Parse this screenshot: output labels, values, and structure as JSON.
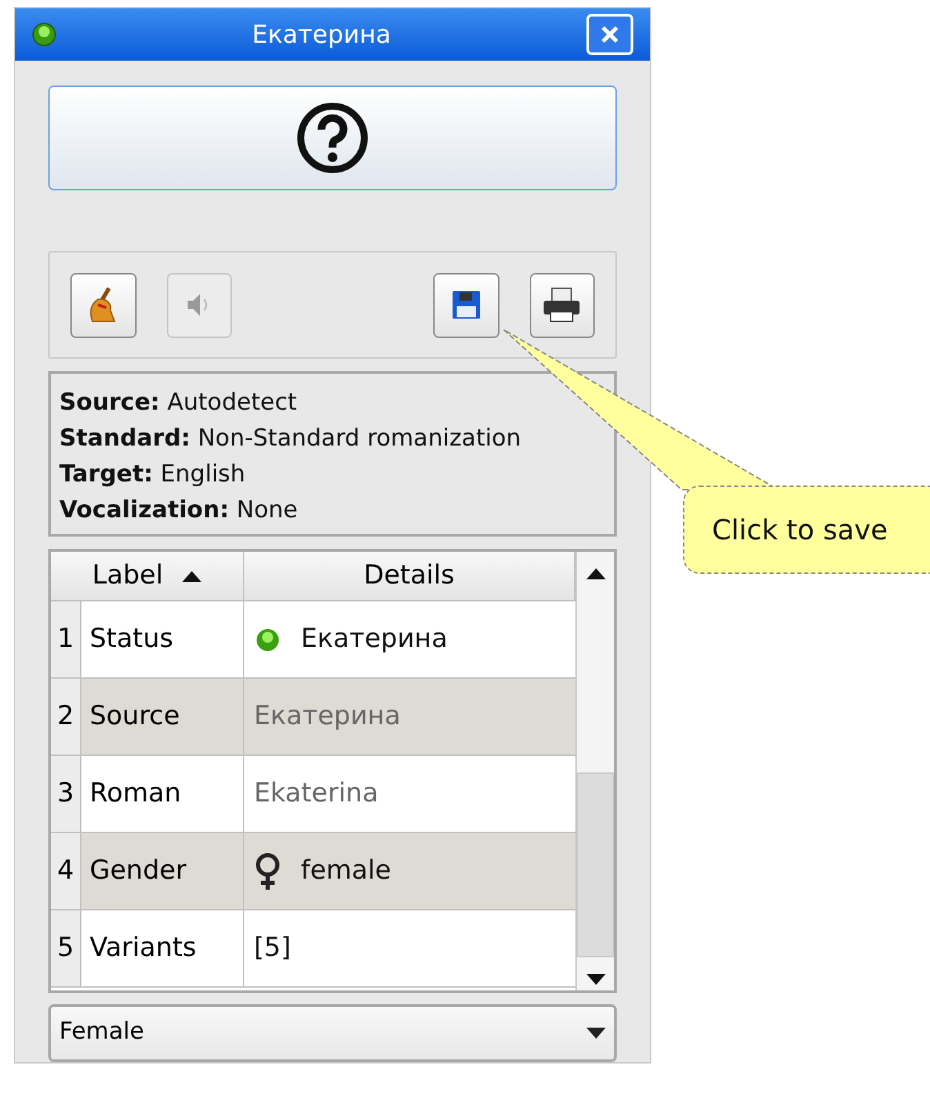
{
  "window": {
    "title": "Екатерина"
  },
  "toolbar": [
    {
      "kind": "broom",
      "disabled": false
    },
    {
      "kind": "speaker",
      "disabled": true
    },
    {
      "kind": "save",
      "disabled": false
    },
    {
      "kind": "print",
      "disabled": false
    }
  ],
  "info": [
    "**Source:** Autodetect",
    "**Standard:** Non-Standard romanization",
    "**Target:** English",
    "**Vocalization:** None"
  ],
  "table": {
    "columns": [
      {
        "label": "Label",
        "sorted": true
      },
      {
        "label": "Details",
        "sorted": false
      }
    ],
    "rows": [
      {
        "number": "1",
        "label": "Status",
        "details": "Екатерина",
        "kind": "status",
        "dimmed": false
      },
      {
        "number": "2",
        "label": "Source",
        "details": "Екатерина",
        "kind": "plain",
        "dimmed": true
      },
      {
        "number": "3",
        "label": "Roman",
        "details": "Ekaterina",
        "kind": "plain",
        "dimmed": true
      },
      {
        "number": "4",
        "label": "Gender",
        "details": "female",
        "kind": "gender",
        "dimmed": false
      },
      {
        "number": "5",
        "label": "Variants",
        "details": "[5]",
        "kind": "plain",
        "dimmed": false
      }
    ]
  },
  "combo": {
    "value": "Female"
  },
  "tooltip": {
    "text": "Click to save"
  }
}
